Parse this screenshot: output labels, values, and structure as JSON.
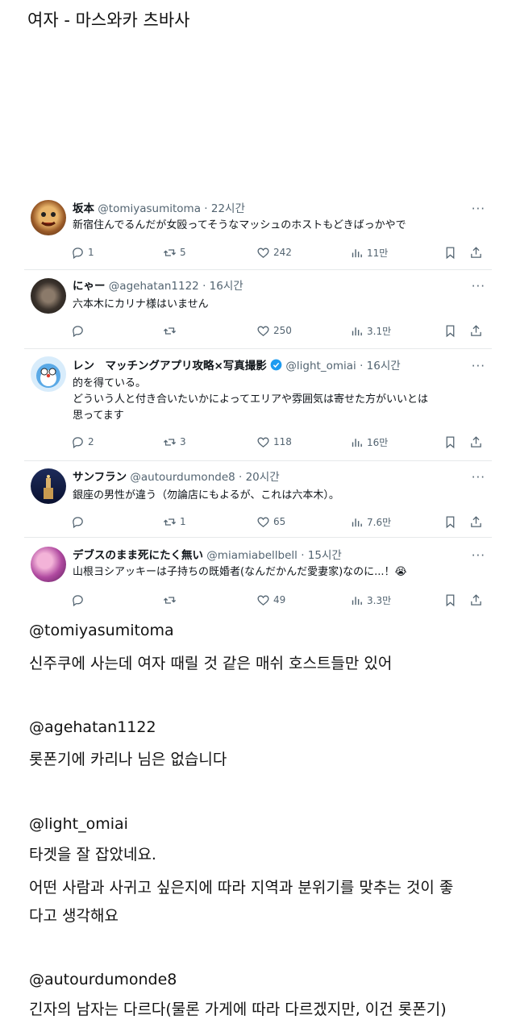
{
  "page_title": "여자 - 마스와카 츠바사",
  "tweets": [
    {
      "name": "坂本",
      "handle": "@tomiyasumitoma",
      "time": "· 22시간",
      "body_lines": [
        "新宿住んでるんだが女殴ってそうなマッシュのホストもどきばっかやで"
      ],
      "replies": "1",
      "retweets": "5",
      "likes": "242",
      "views": "11만"
    },
    {
      "name": "にゃー",
      "handle": "@agehatan1122",
      "time": "· 16시간",
      "body_lines": [
        "六本木にカリナ様はいません"
      ],
      "replies": "",
      "retweets": "",
      "likes": "250",
      "views": "3.1만"
    },
    {
      "name": "レン　マッチングアプリ攻略×写真撮影",
      "handle": "@light_omiai",
      "time": "· 16시간",
      "body_lines": [
        "的を得ている。",
        "どういう人と付き合いたいかによってエリアや雰囲気は寄せた方がいいとは",
        "思ってます"
      ],
      "replies": "2",
      "retweets": "3",
      "likes": "118",
      "views": "16만"
    },
    {
      "name": "サンフラン",
      "handle": "@autourdumonde8",
      "time": "· 20시간",
      "body_lines": [
        "銀座の男性が違う（勿論店にもよるが、これは六本木）。"
      ],
      "replies": "",
      "retweets": "1",
      "likes": "65",
      "views": "7.6만"
    },
    {
      "name": "デブスのまま死にたく無い",
      "handle": "@miamiabellbell",
      "time": "· 15시간",
      "body_lines": [
        "山根ヨシアッキーは子持ちの既婚者(なんだかんだ愛妻家)なのに...！😭"
      ],
      "replies": "",
      "retweets": "",
      "likes": "49",
      "views": "3.3만"
    }
  ],
  "translations": [
    {
      "handle": "@tomiyasumitoma",
      "lines": [
        "신주쿠에 사는데 여자 때릴 것 같은 매쉬 호스트들만 있어"
      ]
    },
    {
      "handle": "@agehatan1122",
      "lines": [
        "롯폰기에 카리나 님은 없습니다"
      ]
    },
    {
      "handle": "@light_omiai",
      "lines": [
        "타겟을 잘 잡았네요.",
        "어떤 사람과 사귀고 싶은지에 따라 지역과 분위기를 맞추는 것이 좋",
        "다고 생각해요"
      ]
    },
    {
      "handle": "@autourdumonde8",
      "lines": [
        "긴자의 남자는 다르다(물론 가게에 따라 다르겠지만, 이건 롯폰기)"
      ]
    }
  ],
  "colors": {
    "verified": "#1d9bf0",
    "muted": "#536471",
    "text": "#0f1419"
  },
  "icons": [
    "reply-icon",
    "retweet-icon",
    "like-icon",
    "views-icon",
    "bookmark-icon",
    "share-icon",
    "more-icon",
    "verified-badge-icon"
  ]
}
